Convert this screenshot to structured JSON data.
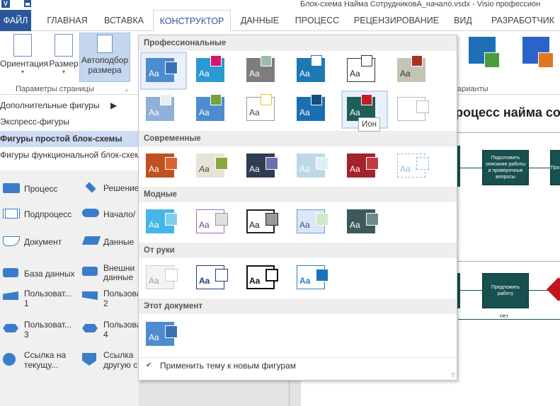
{
  "titlebar": {
    "app_icon_label": "V",
    "title": "Блок-схема Найма СотрудниковА_начало.vsdx - Visio профессион"
  },
  "tabs": [
    {
      "label": "ФАЙЛ"
    },
    {
      "label": "ГЛАВНАЯ"
    },
    {
      "label": "ВСТАВКА"
    },
    {
      "label": "КОНСТРУКТОР"
    },
    {
      "label": "ДАННЫЕ"
    },
    {
      "label": "ПРОЦЕСС"
    },
    {
      "label": "РЕЦЕНЗИРОВАНИЕ"
    },
    {
      "label": "ВИД"
    },
    {
      "label": "РАЗРАБОТЧИК"
    }
  ],
  "ribbon": {
    "orientation": "Ориентация",
    "size": "Размер",
    "autofit_line1": "Автоподбор",
    "autofit_line2": "размера",
    "group_page_setup": "Параметры страницы",
    "group_variants": "арианты"
  },
  "leftpane": {
    "more_shapes": "Дополнительные фигуры",
    "quick_shapes": "Экспресс-фигуры",
    "basic_flowchart": "Фигуры простой блок-схемы",
    "cross_functional": "Фигуры функциональной блок-схем",
    "shapes": [
      {
        "label": "Процесс"
      },
      {
        "label": "Решение"
      },
      {
        "label": "Подпроцесс"
      },
      {
        "label": "Начало/"
      },
      {
        "label": "Документ"
      },
      {
        "label": "Данные"
      },
      {
        "label": "База данных"
      },
      {
        "label": "Внешни данные"
      },
      {
        "label": "Пользоват... 1"
      },
      {
        "label": "Пользоват... 2"
      },
      {
        "label": "Пользоват... 3"
      },
      {
        "label": "Пользоват... 4"
      },
      {
        "label": "Ссылка на текущу..."
      },
      {
        "label": "Ссылка другую с"
      }
    ]
  },
  "canvas": {
    "page_title": "роцесс найма со",
    "box1": "Подготовить описание работы и проверочные вопросы",
    "box2": "Про...",
    "box3": "Предложить работу",
    "no_label": "Нет"
  },
  "themes_panel": {
    "sections": {
      "professional": "Профессиональные",
      "modern": "Современные",
      "trendy": "Модные",
      "handdrawn": "От руки",
      "this_document": "Этот документ"
    },
    "thumb_text": "Aa",
    "tooltip": "Ион",
    "apply_label": "Применить тему к новым фигурам"
  },
  "colors": {
    "accent": "#2b579a",
    "selected_tab_bg": "#ffffff",
    "pane_selected": "#cddcf3",
    "flowchart_box": "#17504e"
  }
}
